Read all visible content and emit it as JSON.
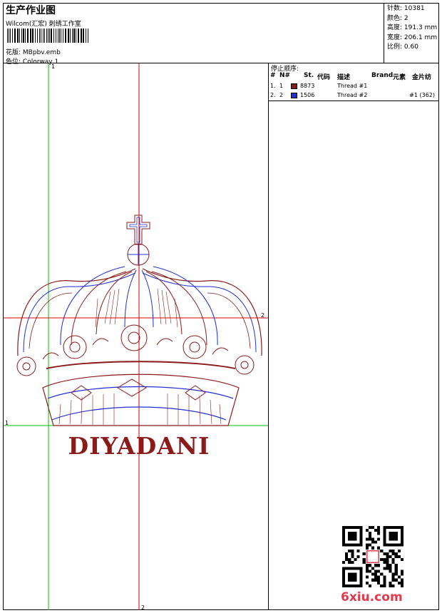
{
  "header": {
    "title": "生产作业图",
    "subtitle": "Wilcom(汇宏) 刺绣工作室",
    "design_label": "花版:",
    "design_value": "MBpbv.emb",
    "colorway_label": "色位:",
    "colorway_value": "Colorway 1"
  },
  "stats": [
    {
      "label": "针数:",
      "value": "10381"
    },
    {
      "label": "颜色:",
      "value": "2"
    },
    {
      "label": "高度:",
      "value": "191.3 mm"
    },
    {
      "label": "宽度:",
      "value": "206.1 mm"
    },
    {
      "label": "比例:",
      "value": "0.60"
    }
  ],
  "design": {
    "text": "DIYADANI",
    "axis_labels": {
      "v_top": "1",
      "h_right": "2",
      "h_left": "1",
      "v_bottom": "2"
    },
    "colors": {
      "thread1": "#8b1a1a",
      "thread2": "#1f2fd6",
      "guide_red": "#e00000",
      "guide_green": "#00c000"
    }
  },
  "stop_sequence": {
    "title": "停止顺序:",
    "headers": {
      "hash": "#",
      "n": "N#",
      "st": "St.",
      "code": "代码",
      "desc": "描述",
      "brand": "Brand",
      "elements": "元素",
      "sequin": "金片纺"
    },
    "rows": [
      {
        "hash": "1.",
        "n": "1",
        "color": "#8b1a1a",
        "code": "8873",
        "desc": "Thread #1",
        "extra": ""
      },
      {
        "hash": "2.",
        "n": "2",
        "color": "#1f2fd6",
        "code": "1506",
        "desc": "Thread #2",
        "extra": "#1 (362)"
      }
    ]
  },
  "watermark": "6xiu.com"
}
